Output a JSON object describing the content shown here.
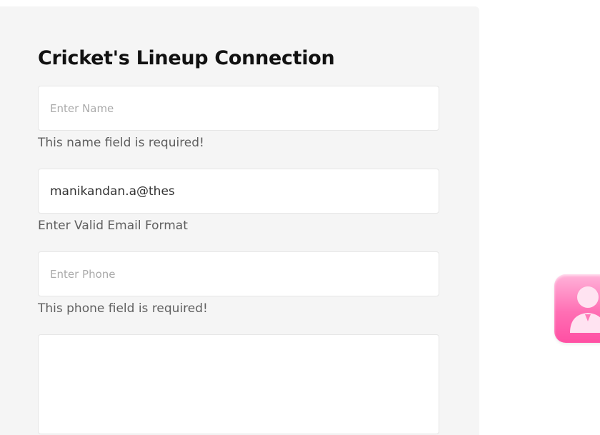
{
  "form": {
    "title": "Cricket's Lineup Connection",
    "name_field": {
      "placeholder": "Enter Name",
      "value": "",
      "error": "This name field is required!"
    },
    "email_field": {
      "placeholder": "",
      "value": "manikandan.a@thes",
      "error": "Enter Valid Email Format"
    },
    "phone_field": {
      "placeholder": "Enter Phone",
      "value": "",
      "error": "This phone field is required!"
    },
    "message_field": {
      "value": ""
    }
  },
  "widget": {
    "icon": "user-support-icon",
    "accent_color": "#ff5fac"
  }
}
